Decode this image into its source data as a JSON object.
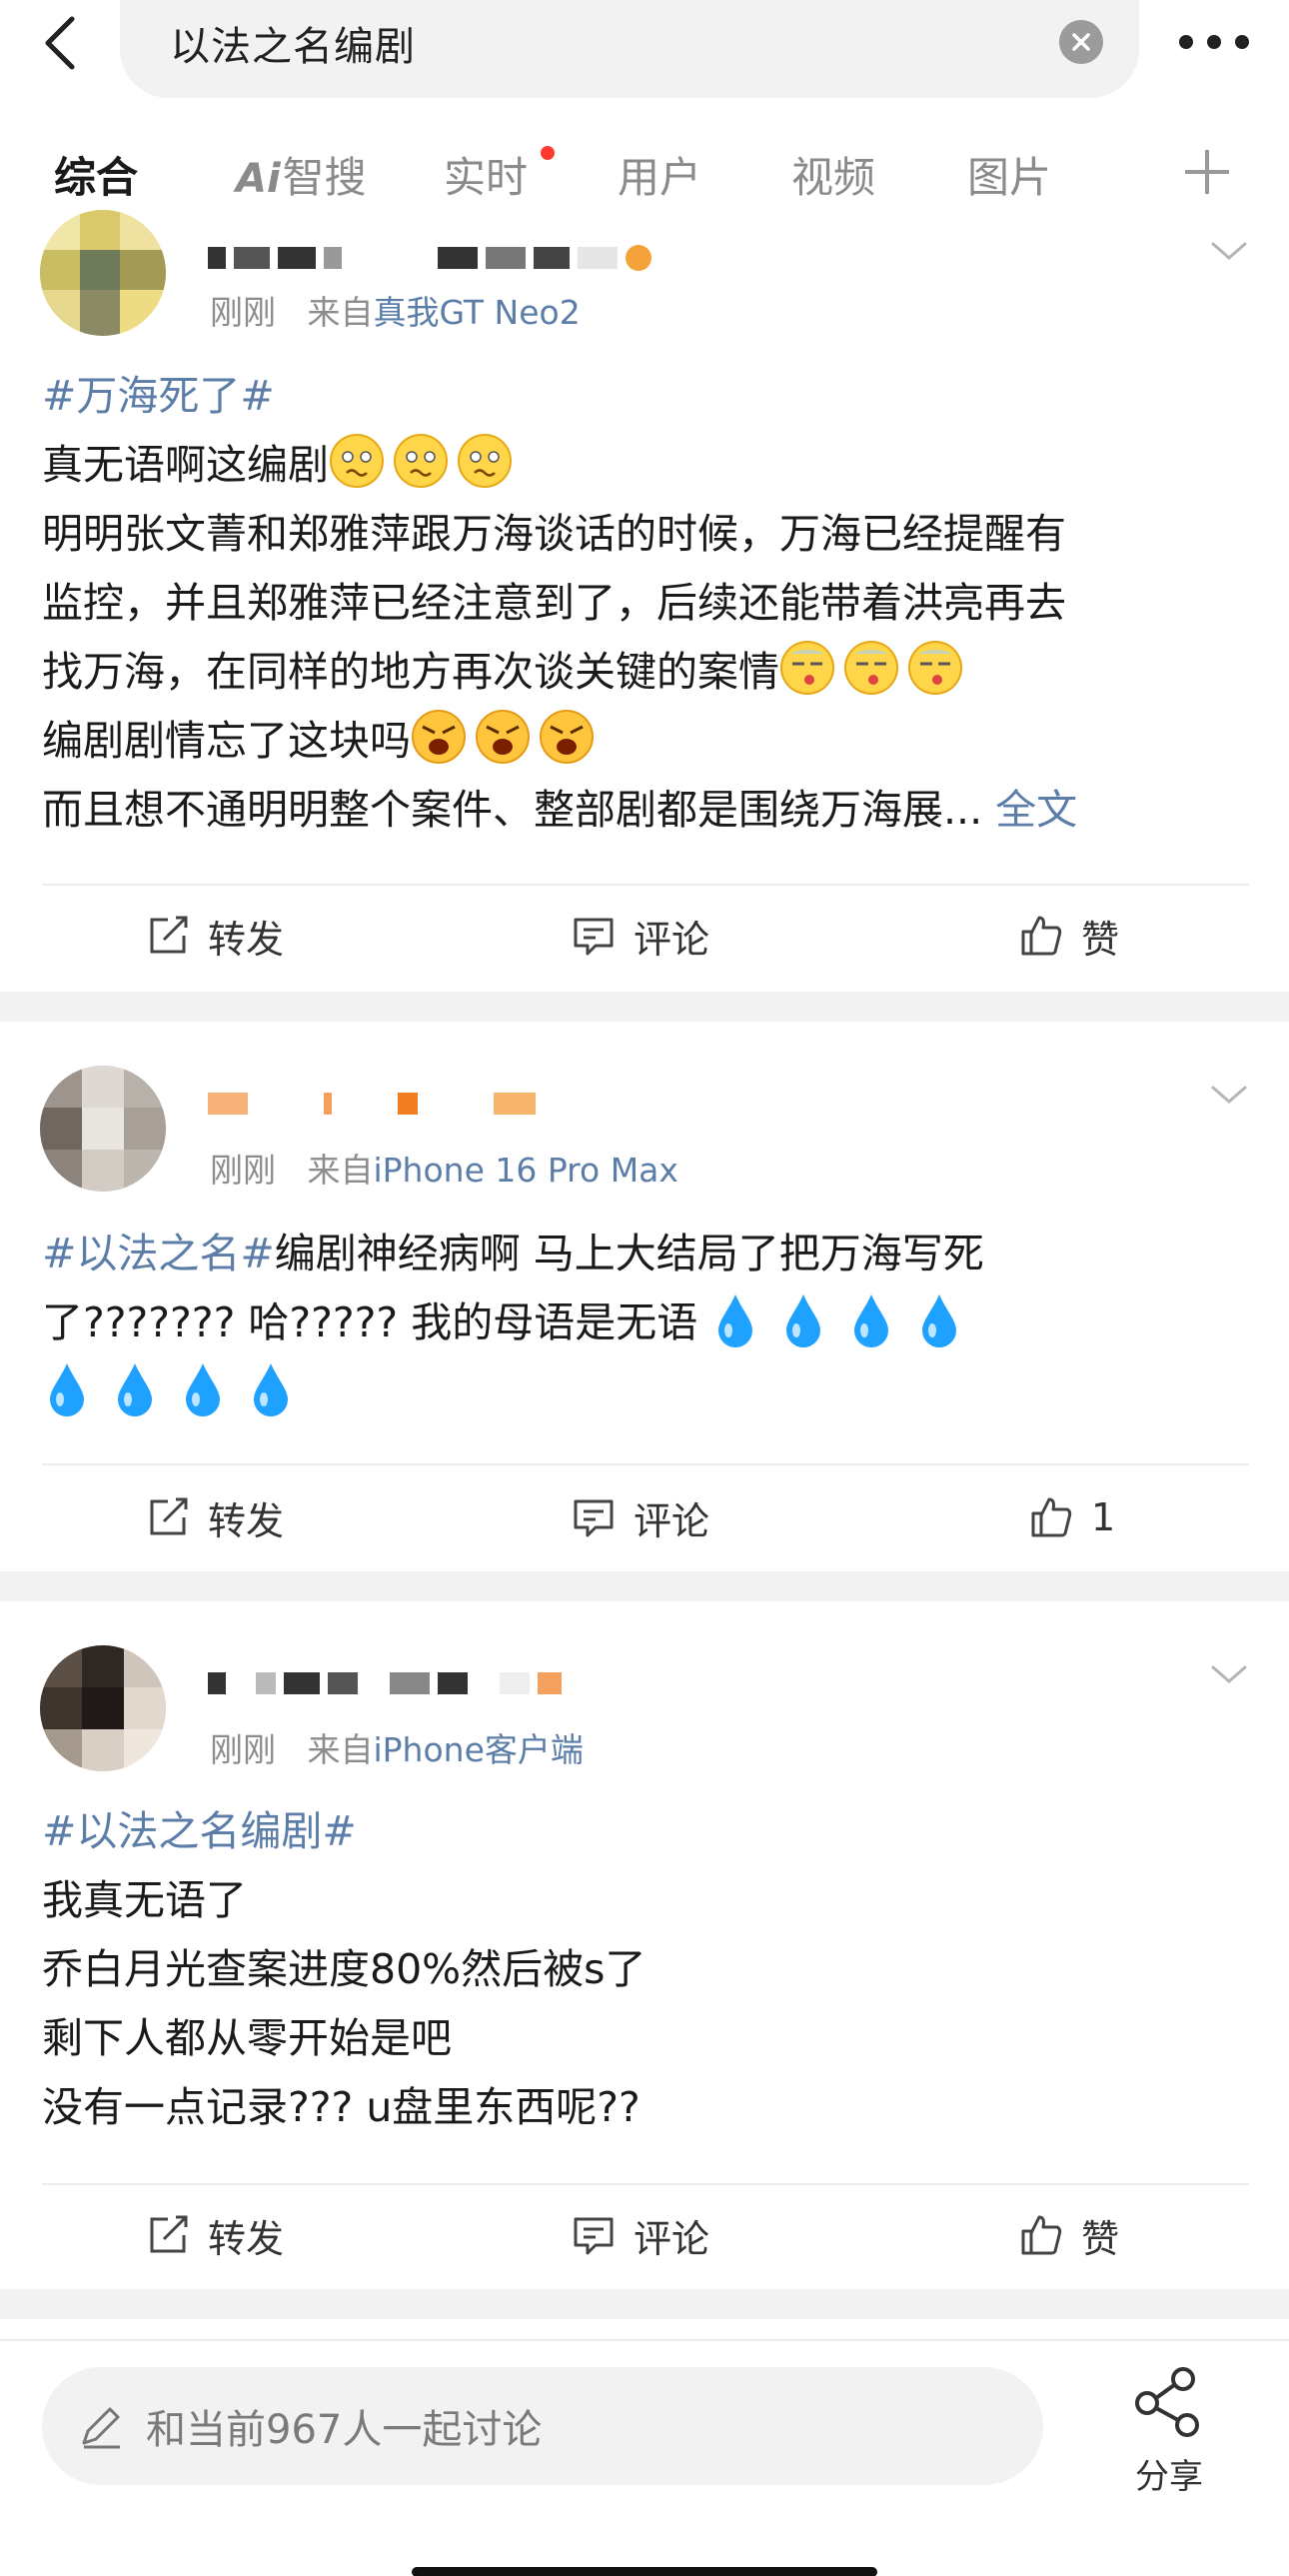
{
  "search": {
    "query": "以法之名编剧"
  },
  "tabs": [
    {
      "label": "综合",
      "active": true
    },
    {
      "label": "智搜",
      "prefix": "Ai"
    },
    {
      "label": "实时",
      "has_dot": true
    },
    {
      "label": "用户"
    },
    {
      "label": "视频"
    },
    {
      "label": "图片"
    }
  ],
  "posts": [
    {
      "time": "刚刚",
      "from_prefix": "来自",
      "device": "真我GT Neo2",
      "topic": "#万海死了#",
      "lines": [
        "真无语啊这编剧",
        "明明张文菁和郑雅萍跟万海谈话的时候，万海已经提醒有",
        "监控，并且郑雅萍已经注意到了，后续还能带着洪亮再去",
        "找万海，在同样的地方再次谈关键的案情",
        "编剧剧情忘了这块吗",
        "而且想不通明明整个案件、整部剧都是围绕万海展..."
      ],
      "more_label": "全文",
      "repost_label": "转发",
      "comment_label": "评论",
      "like_label": "赞"
    },
    {
      "time": "刚刚",
      "from_prefix": "来自",
      "device": "iPhone 16 Pro Max",
      "topic": "#以法之名#",
      "lines": [
        "编剧神经病啊 马上大结局了把万海写死",
        "了??????? 哈????? 我的母语是无语"
      ],
      "repost_label": "转发",
      "comment_label": "评论",
      "like_label": "1"
    },
    {
      "time": "刚刚",
      "from_prefix": "来自",
      "device": "iPhone客户端",
      "topic": "#以法之名编剧#",
      "lines": [
        "我真无语了",
        "乔白月光查案进度80%然后被s了",
        "剩下人都从零开始是吧",
        "没有一点记录??? u盘里东西呢??"
      ],
      "repost_label": "转发",
      "comment_label": "评论",
      "like_label": "赞"
    }
  ],
  "bottom": {
    "comment_placeholder": "和当前967人一起讨论",
    "share_label": "分享"
  },
  "colors": {
    "accent": "#ff8200",
    "link": "#5b7da8",
    "dot": "#ff3b30",
    "muted": "#8c8c8c"
  }
}
